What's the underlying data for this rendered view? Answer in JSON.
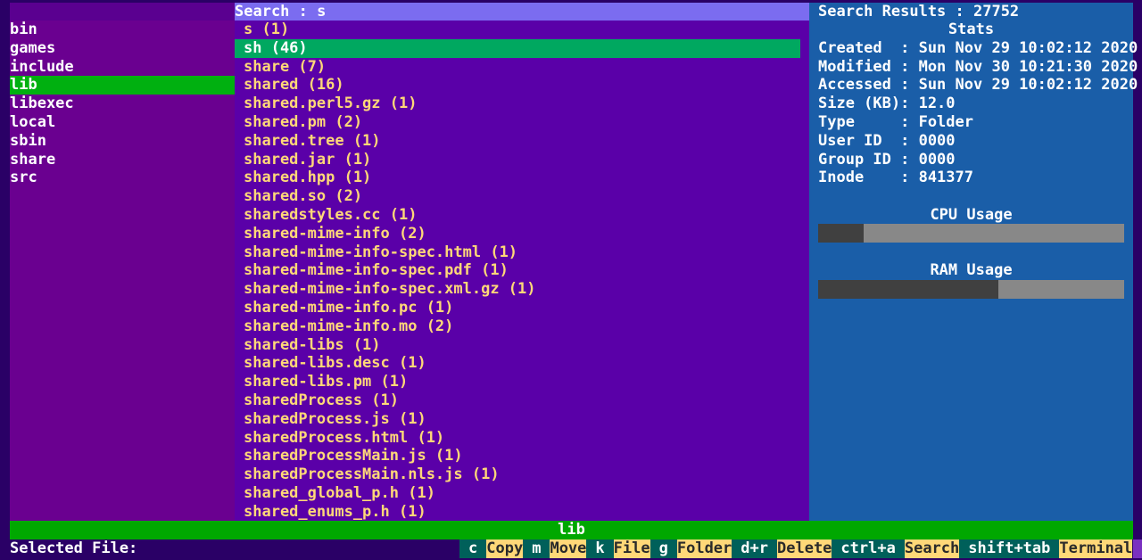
{
  "search": {
    "label": "Search : s"
  },
  "results": {
    "label": "Search Results : 27752"
  },
  "dirs": [
    "bin",
    "games",
    "include",
    "lib",
    "libexec",
    "local",
    "sbin",
    "share",
    "src"
  ],
  "selected_dir_index": 3,
  "matches": [
    "s (1)",
    "sh (46)",
    "share (7)",
    "shared (16)",
    "shared.perl5.gz (1)",
    "shared.pm (2)",
    "shared.tree (1)",
    "shared.jar (1)",
    "shared.hpp (1)",
    "shared.so (2)",
    "sharedstyles.cc (1)",
    "shared-mime-info (2)",
    "shared-mime-info-spec.html (1)",
    "shared-mime-info-spec.pdf (1)",
    "shared-mime-info-spec.xml.gz (1)",
    "shared-mime-info.pc (1)",
    "shared-mime-info.mo (2)",
    "shared-libs (1)",
    "shared-libs.desc (1)",
    "shared-libs.pm (1)",
    "sharedProcess (1)",
    "sharedProcess.js (1)",
    "sharedProcess.html (1)",
    "sharedProcessMain.js (1)",
    "sharedProcessMain.nls.js (1)",
    "shared_global_p.h (1)",
    "shared_enums_p.h (1)"
  ],
  "selected_match_index": 1,
  "stats": {
    "title": "Stats",
    "rows": [
      "Created  : Sun Nov 29 10:02:12 2020",
      "Modified : Mon Nov 30 10:21:30 2020",
      "Accessed : Sun Nov 29 10:02:12 2020",
      "Size (KB): 12.0",
      "Type     : Folder",
      "User ID  : 0000",
      "Group ID : 0000",
      "Inode    : 841377"
    ],
    "cpu_label": "CPU Usage",
    "cpu_usage": 0.15,
    "ram_label": "RAM Usage",
    "ram_usage": 0.59
  },
  "status": {
    "current": "lib",
    "selected_file_label": "Selected File:"
  },
  "shortcuts": [
    {
      "key": "c",
      "action": "Copy"
    },
    {
      "key": "m",
      "action": "Move"
    },
    {
      "key": "k",
      "action": "File"
    },
    {
      "key": "g",
      "action": "Folder"
    },
    {
      "key": "d+r",
      "action": "Delete"
    },
    {
      "key": "ctrl+a",
      "action": "Search"
    },
    {
      "key": "shift+tab",
      "action": "Terminal"
    }
  ],
  "colors": {
    "background": "#2a0066",
    "left_pane": "#6a0090",
    "middle_pane": "#5a00a8",
    "right_pane": "#1a5ea8",
    "search_bar": "#7b6cf0",
    "selected_dir": "#00b010",
    "selected_match": "#00a860",
    "match_text": "#ffd878",
    "status_bar": "#00a800",
    "key_bg": "#00605a",
    "action_bg": "#ffd878"
  }
}
